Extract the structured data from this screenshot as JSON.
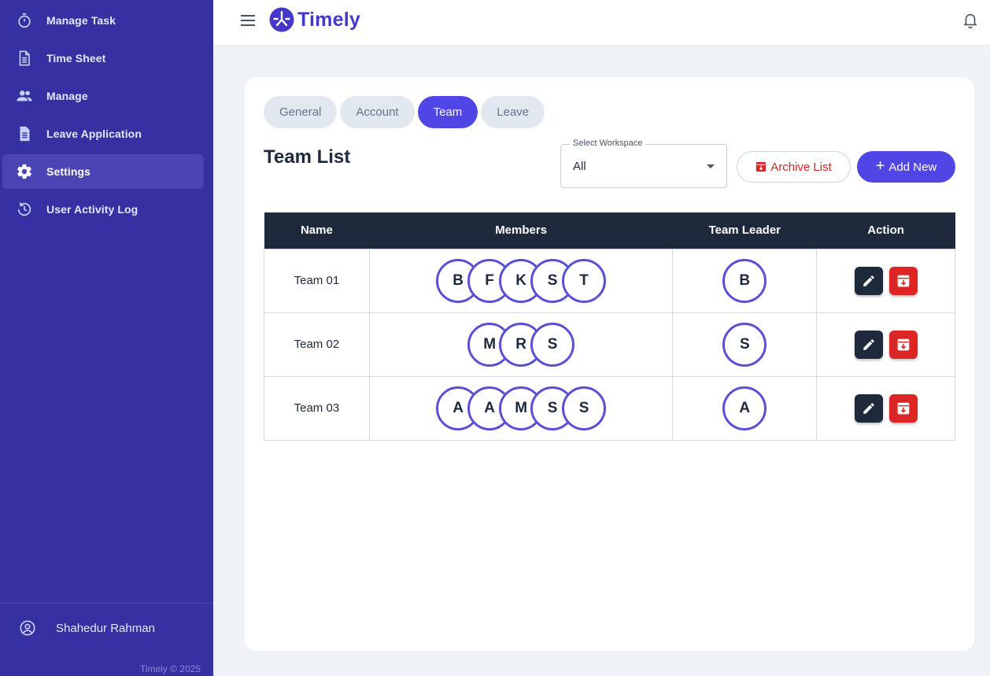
{
  "sidebar": {
    "items": [
      {
        "label": "Manage Task",
        "icon": "timer-icon"
      },
      {
        "label": "Time Sheet",
        "icon": "document-icon"
      },
      {
        "label": "Manage",
        "icon": "people-icon"
      },
      {
        "label": "Leave Application",
        "icon": "file-icon"
      },
      {
        "label": "Settings",
        "icon": "gear-icon",
        "active": true
      },
      {
        "label": "User Activity Log",
        "icon": "history-icon"
      }
    ],
    "user_name": "Shahedur Rahman",
    "copyright": "Timely © 2025"
  },
  "header": {
    "brand": "Timely"
  },
  "tabs": [
    {
      "label": "General"
    },
    {
      "label": "Account"
    },
    {
      "label": "Team",
      "active": true
    },
    {
      "label": "Leave"
    }
  ],
  "page": {
    "title": "Team List"
  },
  "workspace": {
    "legend": "Select Workspace",
    "value": "All"
  },
  "buttons": {
    "archive": "Archive List",
    "add_new": "Add New"
  },
  "table": {
    "headers": [
      "Name",
      "Members",
      "Team Leader",
      "Action"
    ],
    "rows": [
      {
        "name": "Team 01",
        "members": [
          "B",
          "F",
          "K",
          "S",
          "T"
        ],
        "leader": "B"
      },
      {
        "name": "Team 02",
        "members": [
          "M",
          "R",
          "S"
        ],
        "leader": "S"
      },
      {
        "name": "Team 03",
        "members": [
          "A",
          "A",
          "M",
          "S",
          "S"
        ],
        "leader": "A"
      }
    ]
  },
  "colors": {
    "sidebar": "#3730a3",
    "accent": "#4f46e5",
    "danger": "#dc2626",
    "table_header": "#1e293b"
  }
}
